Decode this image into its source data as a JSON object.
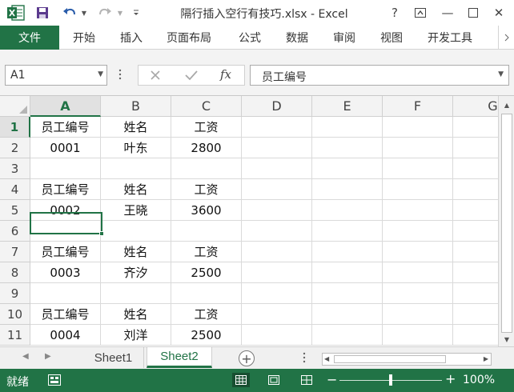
{
  "window": {
    "title": "隔行插入空行有技巧.xlsx - Excel",
    "help_label": "?",
    "minimize_glyph": "—",
    "close_glyph": "✕"
  },
  "ribbon": {
    "file_label": "文件",
    "tabs": [
      "开始",
      "插入",
      "页面布局",
      "公式",
      "数据",
      "审阅",
      "视图",
      "开发工具"
    ]
  },
  "formula_bar": {
    "name_box": "A1",
    "formula_value": "员工编号",
    "fx_label": "fx"
  },
  "grid": {
    "columns": [
      "A",
      "B",
      "C",
      "D",
      "E",
      "F",
      "G"
    ],
    "selected_column": "A",
    "selected_row": "1",
    "rows": [
      {
        "num": "1",
        "cells": [
          "员工编号",
          "姓名",
          "工资"
        ]
      },
      {
        "num": "2",
        "cells": [
          "0001",
          "叶东",
          "2800"
        ]
      },
      {
        "num": "3",
        "cells": [
          "",
          "",
          ""
        ]
      },
      {
        "num": "4",
        "cells": [
          "员工编号",
          "姓名",
          "工资"
        ]
      },
      {
        "num": "5",
        "cells": [
          "0002",
          "王晓",
          "3600"
        ]
      },
      {
        "num": "6",
        "cells": [
          "",
          "",
          ""
        ]
      },
      {
        "num": "7",
        "cells": [
          "员工编号",
          "姓名",
          "工资"
        ]
      },
      {
        "num": "8",
        "cells": [
          "0003",
          "齐汐",
          "2500"
        ]
      },
      {
        "num": "9",
        "cells": [
          "",
          "",
          ""
        ]
      },
      {
        "num": "10",
        "cells": [
          "员工编号",
          "姓名",
          "工资"
        ]
      },
      {
        "num": "11",
        "cells": [
          "0004",
          "刘洋",
          "2500"
        ]
      }
    ]
  },
  "sheets": {
    "tabs": [
      "Sheet1",
      "Sheet2"
    ],
    "active": "Sheet2"
  },
  "status": {
    "text": "就绪",
    "zoom": "100%",
    "zoom_minus": "−",
    "zoom_plus": "+"
  },
  "colors": {
    "accent": "#217346"
  }
}
